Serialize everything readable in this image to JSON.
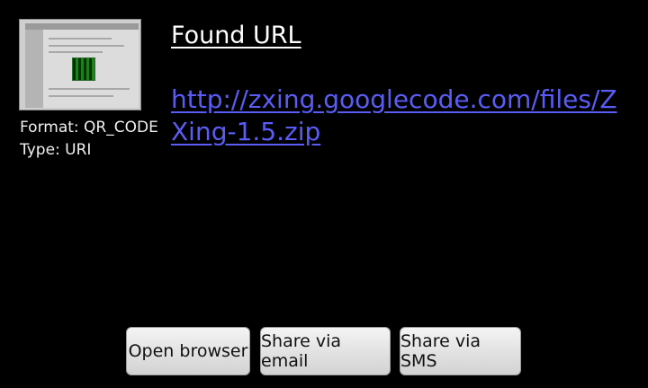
{
  "result": {
    "title": "Found URL",
    "url": "http://zxing.googlecode.com/files/ZXing-1.5.zip",
    "format_label": "Format: QR_CODE",
    "type_label": "Type: URI",
    "thumbnail_icon": "barcode-photo-thumbnail"
  },
  "actions": {
    "open_browser": "Open browser",
    "share_email": "Share via email",
    "share_sms": "Share via SMS"
  }
}
